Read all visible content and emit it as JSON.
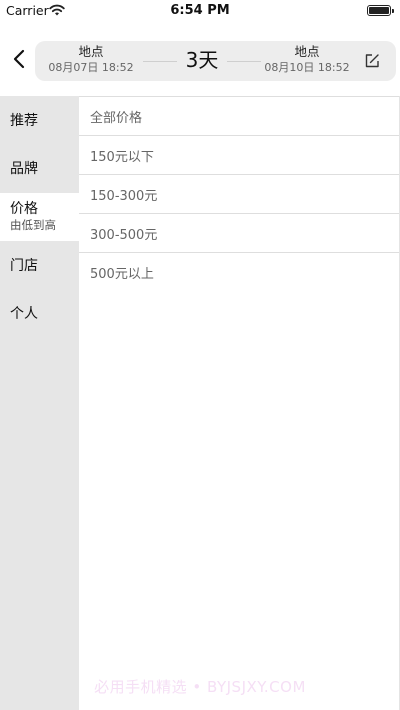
{
  "status": {
    "carrier": "Carrier",
    "time": "6:54 PM",
    "battery_level": 1.0
  },
  "header": {
    "start": {
      "place": "地点",
      "datetime": "08月07日 18:52"
    },
    "duration": "3天",
    "end": {
      "place": "地点",
      "datetime": "08月10日 18:52"
    },
    "icons": {
      "back": "chevron-left-icon",
      "edit": "edit-icon"
    }
  },
  "sidebar": {
    "items": [
      {
        "label": "推荐"
      },
      {
        "label": "品牌"
      },
      {
        "label": "价格",
        "sub": "由低到高",
        "active": true
      },
      {
        "label": "门店"
      },
      {
        "label": "个人"
      }
    ]
  },
  "price_options": [
    {
      "label": "全部价格"
    },
    {
      "label": "150元以下"
    },
    {
      "label": "150-300元"
    },
    {
      "label": "300-500元"
    },
    {
      "label": "500元以上"
    }
  ],
  "watermark": "必用手机精选 • BYJSJXY.COM",
  "colors": {
    "sidebar_bg": "#e6e6e6",
    "pill_bg": "#ededed",
    "option_text": "#666666"
  }
}
